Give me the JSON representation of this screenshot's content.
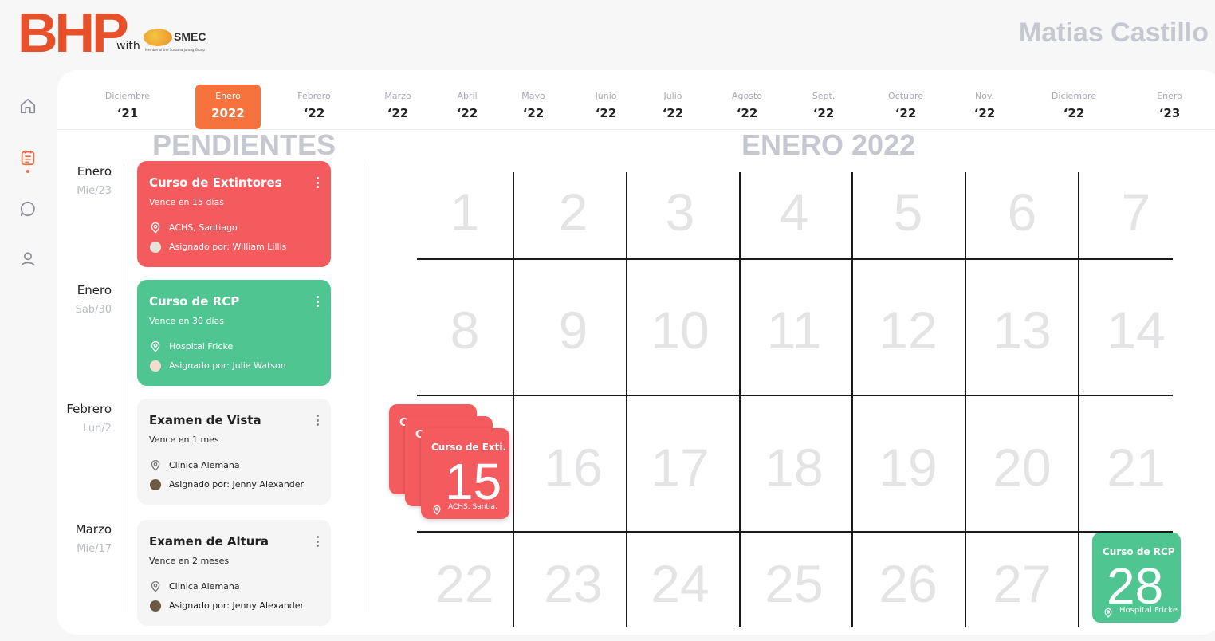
{
  "header": {
    "brand": "BHP",
    "brand_with": "with",
    "partner": "SMEC",
    "partner_sub": "Member of the Surbana Jurong Group",
    "user_name": "Matias Castillo"
  },
  "colors": {
    "accent": "#f7733d",
    "red": "#f45b5f",
    "green": "#4fc592",
    "muted": "#c5c8d1"
  },
  "nav": [
    "home-icon",
    "checklist-icon",
    "chat-icon",
    "user-icon"
  ],
  "months": [
    {
      "name": "Diciembre",
      "year": "‘21"
    },
    {
      "name": "Enero",
      "year": "2022"
    },
    {
      "name": "Febrero",
      "year": "‘22"
    },
    {
      "name": "Marzo",
      "year": "‘22"
    },
    {
      "name": "Abril",
      "year": "‘22"
    },
    {
      "name": "Mayo",
      "year": "‘22"
    },
    {
      "name": "Junio",
      "year": "‘22"
    },
    {
      "name": "Julio",
      "year": "‘22"
    },
    {
      "name": "Agosto",
      "year": "‘22"
    },
    {
      "name": "Sept.",
      "year": "‘22"
    },
    {
      "name": "Octubre",
      "year": "‘22"
    },
    {
      "name": "Nov.",
      "year": "‘22"
    },
    {
      "name": "Diciembre",
      "year": "‘22"
    },
    {
      "name": "Enero",
      "year": "‘23"
    }
  ],
  "pending": {
    "title": "PENDIENTES",
    "items": [
      {
        "month": "Enero",
        "day": "Mie/23",
        "title": "Curso de Extintores",
        "due": "Vence en 15 días",
        "location": "ACHS, Santiago",
        "assigned": "Asignado por: William Lillis"
      },
      {
        "month": "Enero",
        "day": "Sab/30",
        "title": "Curso de RCP",
        "due": "Vence en 30 días",
        "location": "Hospital Fricke",
        "assigned": "Asignado por: Julie Watson"
      },
      {
        "month": "Febrero",
        "day": "Lun/2",
        "title": "Examen de Vista",
        "due": "Vence en 1 mes",
        "location": "Clinica Alemana",
        "assigned": "Asignado por: Jenny Alexander"
      },
      {
        "month": "Marzo",
        "day": "Mie/17",
        "title": "Examen de Altura",
        "due": "Vence en 2 meses",
        "location": "Clinica Alemana",
        "assigned": "Asignado por: Jenny Alexander"
      }
    ]
  },
  "calendar": {
    "title": "ENERO 2022",
    "weeks": [
      [
        "1",
        "2",
        "3",
        "4",
        "5",
        "6",
        "7"
      ],
      [
        "8",
        "9",
        "10",
        "11",
        "12",
        "13",
        "14"
      ],
      [
        "15",
        "16",
        "17",
        "18",
        "19",
        "20",
        "21"
      ],
      [
        "22",
        "23",
        "24",
        "25",
        "26",
        "27",
        "28"
      ]
    ],
    "event_15": {
      "title": "Curso de Exti.",
      "day": "15",
      "location": "ACHS, Santia.",
      "stack_letter": "C"
    },
    "event_28": {
      "title": "Curso de RCP",
      "day": "28",
      "location": "Hospital Fricke"
    }
  }
}
